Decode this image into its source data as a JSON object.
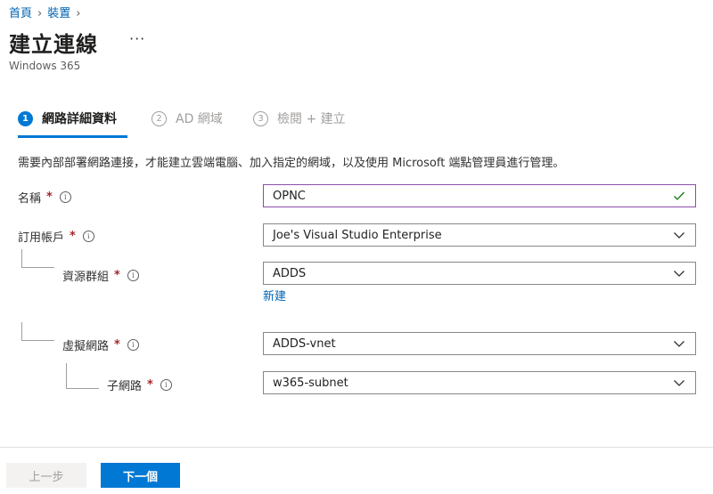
{
  "breadcrumb": {
    "home": "首頁",
    "devices": "裝置",
    "sep": "›"
  },
  "page": {
    "title": "建立連線",
    "more": "···",
    "subtitle": "Windows 365"
  },
  "steps": [
    {
      "num": "1",
      "label": "網路詳細資料"
    },
    {
      "num": "2",
      "label": "AD 網域"
    },
    {
      "num": "3",
      "label": "檢閱 + 建立"
    }
  ],
  "description": "需要內部部署網路連接，才能建立雲端電腦、加入指定的網域，以及使用 Microsoft 端點管理員進行管理。",
  "form": {
    "required_mark": "*",
    "info_glyph": "i",
    "name": {
      "label": "名稱",
      "value": "OPNC"
    },
    "subscription": {
      "label": "訂用帳戶",
      "value": "Joe's Visual Studio Enterprise"
    },
    "resource_group": {
      "label": "資源群組",
      "value": "ADDS",
      "create_new": "新建"
    },
    "vnet": {
      "label": "虛擬網路",
      "value": "ADDS-vnet"
    },
    "subnet": {
      "label": "子網路",
      "value": "w365-subnet"
    }
  },
  "buttons": {
    "previous": "上一步",
    "next": "下一個"
  },
  "colors": {
    "accent": "#0078d4",
    "valid": "#107c10",
    "required": "#a4262c",
    "link": "#0063b1"
  }
}
